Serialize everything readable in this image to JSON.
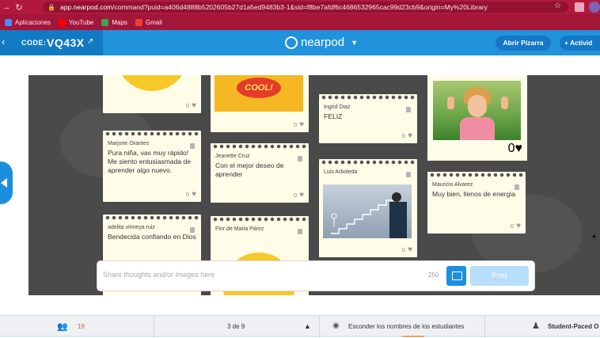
{
  "browser": {
    "url_host": "app.nearpod.com",
    "url_rest": "/command?puid=a406d4888b5202605b27d1a5ed9483b3-1&sid=f8be7afdf6c4686532965cac99d23cb9&origin=My%20Library",
    "bookmarks": [
      {
        "label": "Aplicaciones",
        "color": "#4c8bf5"
      },
      {
        "label": "YouTube",
        "color": "#ff0000"
      },
      {
        "label": "Maps",
        "color": "#34a853"
      },
      {
        "label": "Gmail",
        "color": "#ea4335"
      }
    ]
  },
  "header": {
    "code_label": "CODE:",
    "code_value": "VQ43X",
    "logo_text": "nearpod",
    "abrir_label": "Abrir Pizarra",
    "actividad_label": "+ Activid"
  },
  "notes": [
    {
      "author": "Marjorie Orantes",
      "text": "Pura niña, vas muy rápido! Me siento entusiasmada de aprender algo nuevo.",
      "likes": "0"
    },
    {
      "author": "Jeanette Cruz",
      "text": "Con el mejor deseo de aprender",
      "likes": "0"
    },
    {
      "author": "Ingrid Diaz",
      "text": "FELIZ",
      "likes": "0"
    },
    {
      "author": "Luis Arboleda",
      "text": "",
      "likes": "0"
    },
    {
      "author": "Mauricio Alvarez",
      "text": "Muy bien, llenos de energia",
      "likes": "0"
    },
    {
      "author": "adelita virineya ruiz",
      "text": "Bendecida confiando en Dios",
      "likes": ""
    },
    {
      "author": "Flor de Maria Párez",
      "text": "",
      "likes": ""
    }
  ],
  "top_notes": {
    "note1_likes": "0",
    "note2_likes": "0",
    "kid_likes": "0"
  },
  "images": {
    "cool_text": "COOL!"
  },
  "composer": {
    "placeholder": "Share thoughts and/or images here",
    "char_count": "250",
    "post_label": "Post"
  },
  "footer": {
    "students_count": "19",
    "page_indicator": "3 de 9",
    "hide_names": "Esconder los nombres de los estudiantes",
    "student_paced": "Student-Paced O"
  },
  "colors": {
    "browser_bar": "#b1193c",
    "nearpod_blue": "#2193dd",
    "board": "#4a4a4a",
    "note_paper": "#fffce8"
  }
}
